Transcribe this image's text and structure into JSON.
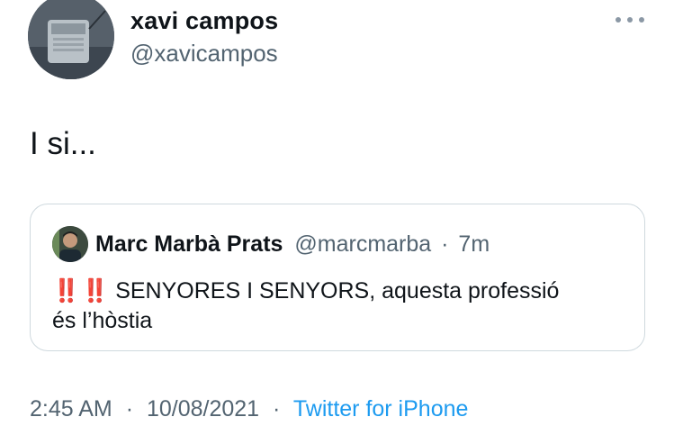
{
  "author": {
    "display_name": "xavi campos",
    "handle": "@xavicampos",
    "avatar_icon": "avatar-photo-radio"
  },
  "tweet": {
    "text": "I si..."
  },
  "quoted_tweet": {
    "display_name": "Marc Marbà Prats",
    "handle": "@marcmarba",
    "separator": "·",
    "age": "7m",
    "emoji": "‼️ ‼️",
    "text_line_1": "SENYORES I SENYORS, aquesta professió",
    "text_line_2": "és l’hòstia"
  },
  "footer": {
    "time": "2:45 AM",
    "sep1": "·",
    "date": "10/08/2021",
    "sep2": "·",
    "source": "Twitter for iPhone"
  },
  "colors": {
    "text_primary": "#0f1419",
    "text_secondary": "#536471",
    "link": "#1d9bf0",
    "border": "#cfd9de"
  }
}
